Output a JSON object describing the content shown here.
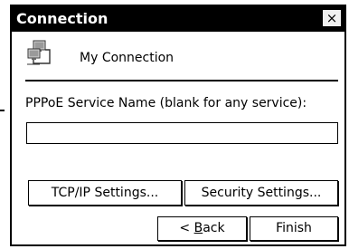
{
  "window": {
    "title": "Connection",
    "close_glyph": "×",
    "icon": "network-connection-icon"
  },
  "connection": {
    "name": "My Connection"
  },
  "pppoe": {
    "label": "PPPoE Service Name (blank for any service):",
    "value": ""
  },
  "buttons": {
    "tcpip": "TCP/IP Settings...",
    "security": "Security Settings...",
    "back_prefix": "< ",
    "back_mnemonic": "B",
    "back_rest": "ack",
    "finish": "Finish"
  }
}
